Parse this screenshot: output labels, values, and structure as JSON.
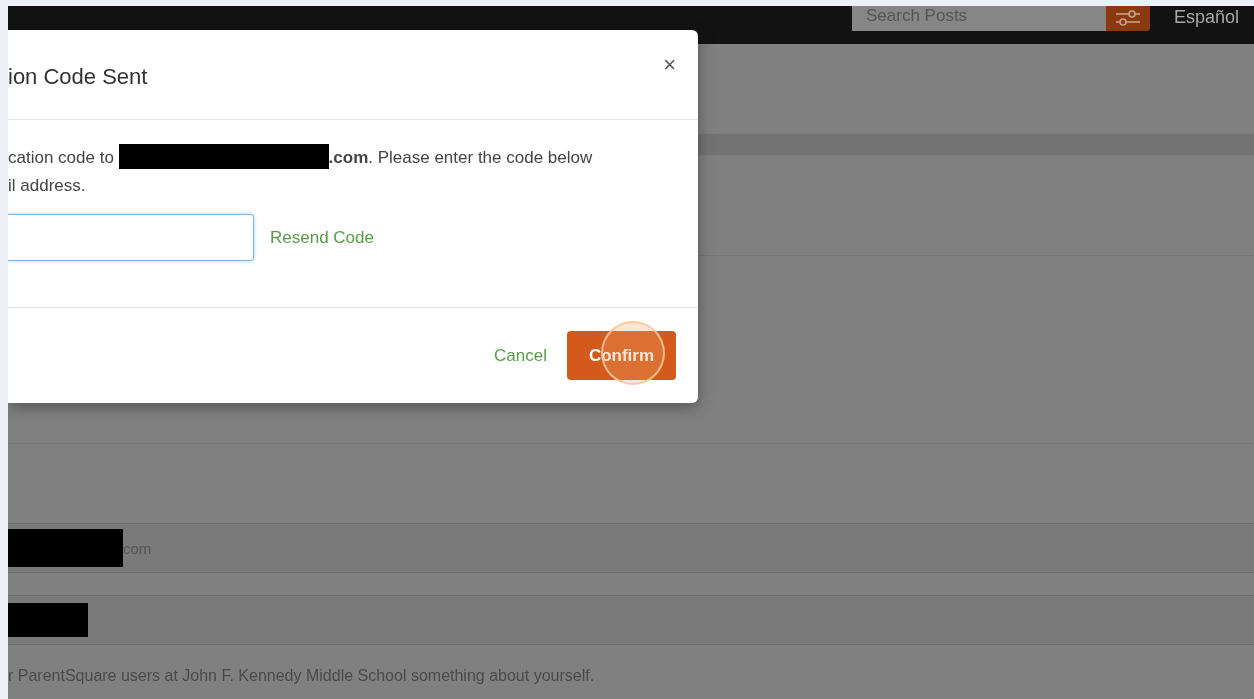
{
  "header": {
    "search": {
      "placeholder": "Search Posts"
    },
    "language": "Español"
  },
  "page": {
    "email_row": {
      "suffix": "com"
    },
    "bio_hint": "r ParentSquare users at John F. Kennedy Middle School something about yourself."
  },
  "modal": {
    "title": "ion Code Sent",
    "close": "×",
    "message": {
      "before": "cation code to",
      "after": "**.com**. Please enter the code below",
      "line_2": "il address."
    },
    "resend": "Resend Code",
    "cancel": "Cancel",
    "confirm": "Confirm"
  }
}
